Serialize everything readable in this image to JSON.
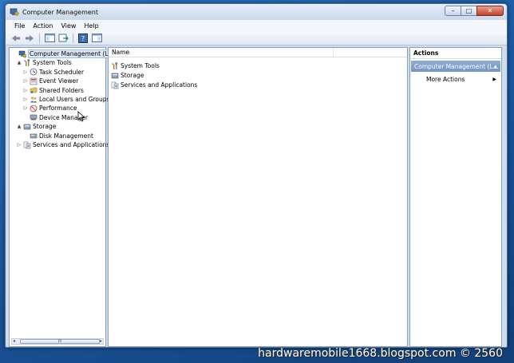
{
  "window": {
    "title": "Computer Management"
  },
  "menu": [
    "File",
    "Action",
    "View",
    "Help"
  ],
  "tree": {
    "items": [
      {
        "label": "Computer Management (Local",
        "level": 0,
        "expander": "",
        "icon": "computer-icon",
        "selected": true
      },
      {
        "label": "System Tools",
        "level": 1,
        "expander": "▲",
        "icon": "tools-icon"
      },
      {
        "label": "Task Scheduler",
        "level": 2,
        "expander": "▷",
        "icon": "clock-icon"
      },
      {
        "label": "Event Viewer",
        "level": 2,
        "expander": "▷",
        "icon": "event-viewer-icon"
      },
      {
        "label": "Shared Folders",
        "level": 2,
        "expander": "▷",
        "icon": "shared-folder-icon"
      },
      {
        "label": "Local Users and Groups",
        "level": 2,
        "expander": "▷",
        "icon": "users-icon"
      },
      {
        "label": "Performance",
        "level": 2,
        "expander": "▷",
        "icon": "performance-icon"
      },
      {
        "label": "Device Manager",
        "level": 2,
        "expander": "",
        "icon": "device-manager-icon"
      },
      {
        "label": "Storage",
        "level": 1,
        "expander": "▲",
        "icon": "storage-icon"
      },
      {
        "label": "Disk Management",
        "level": 2,
        "expander": "",
        "icon": "disk-icon"
      },
      {
        "label": "Services and Applications",
        "level": 1,
        "expander": "▷",
        "icon": "services-icon"
      }
    ],
    "scroll_thumb": "III"
  },
  "list": {
    "column_name": "Name",
    "rows": [
      {
        "label": "System Tools",
        "icon": "tools-icon"
      },
      {
        "label": "Storage",
        "icon": "storage-icon"
      },
      {
        "label": "Services and Applications",
        "icon": "services-icon"
      }
    ]
  },
  "actions": {
    "title": "Actions",
    "section": "Computer Management (L...",
    "section_caret": "▲",
    "items": [
      {
        "label": "More Actions",
        "arrow": "▶"
      }
    ]
  },
  "watermark": "hardwaremobile1668.blogspot.com © 2560",
  "colors": {
    "selection": "#dbe8f7",
    "actions_header": "#7f9fc9"
  }
}
